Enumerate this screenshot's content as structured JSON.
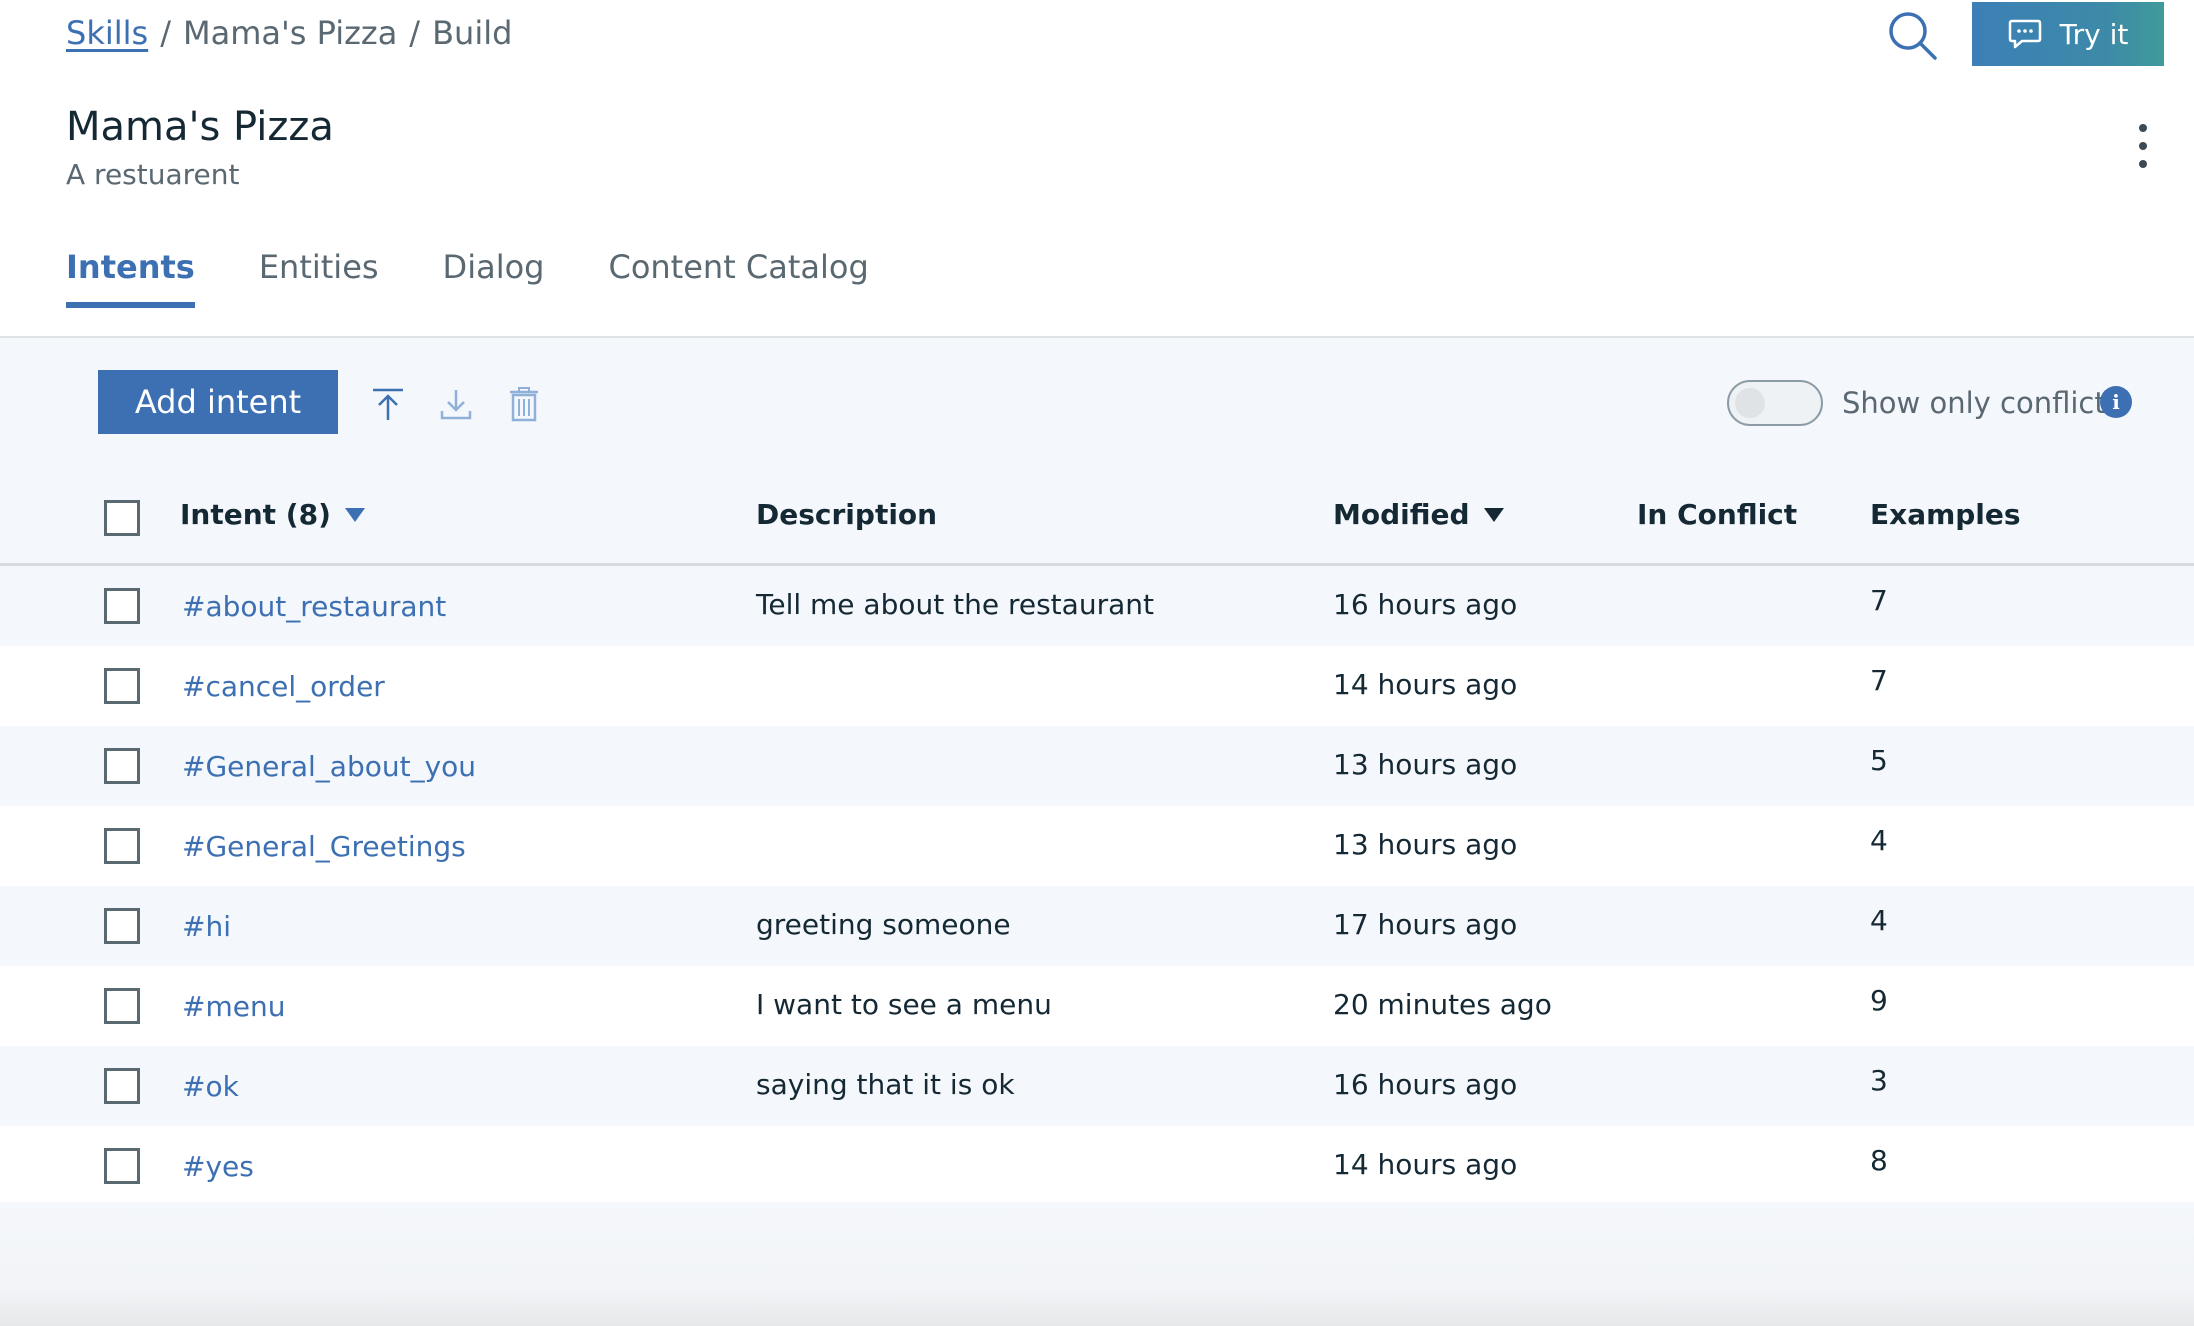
{
  "breadcrumb": {
    "root": "Skills",
    "middle": "Mama's Pizza",
    "current": "Build",
    "separator": "/"
  },
  "header": {
    "try_label": "Try it",
    "search_icon": "search-icon",
    "chat_icon": "chat-icon"
  },
  "skill": {
    "title": "Mama's Pizza",
    "subtitle": "A restuarent"
  },
  "tabs": [
    {
      "label": "Intents",
      "active": true
    },
    {
      "label": "Entities",
      "active": false
    },
    {
      "label": "Dialog",
      "active": false
    },
    {
      "label": "Content Catalog",
      "active": false
    }
  ],
  "toolbar": {
    "add_label": "Add intent",
    "upload_icon": "upload-icon",
    "download_icon": "download-icon",
    "delete_icon": "trash-icon",
    "conflicts_label": "Show only conflicts",
    "conflicts_on": false
  },
  "table": {
    "headers": {
      "intent": "Intent (8)",
      "description": "Description",
      "modified": "Modified",
      "conflict": "In Conflict",
      "examples": "Examples"
    },
    "rows": [
      {
        "intent": "#about_restaurant",
        "description": "Tell me about the restaurant",
        "modified": "16 hours ago",
        "examples": "7"
      },
      {
        "intent": "#cancel_order",
        "description": "",
        "modified": "14 hours ago",
        "examples": "7"
      },
      {
        "intent": "#General_about_you",
        "description": "",
        "modified": "13 hours ago",
        "examples": "5"
      },
      {
        "intent": "#General_Greetings",
        "description": "",
        "modified": "13 hours ago",
        "examples": "4"
      },
      {
        "intent": "#hi",
        "description": "greeting someone",
        "modified": "17 hours ago",
        "examples": "4"
      },
      {
        "intent": "#menu",
        "description": "I want to see a menu",
        "modified": "20 minutes ago",
        "examples": "9"
      },
      {
        "intent": "#ok",
        "description": "saying that it is ok",
        "modified": "16 hours ago",
        "examples": "3"
      },
      {
        "intent": "#yes",
        "description": "",
        "modified": "14 hours ago",
        "examples": "8"
      }
    ]
  },
  "colors": {
    "accent": "#3d70b2",
    "text": "#152935",
    "muted": "#5a6872",
    "band": "#f4f7fb"
  }
}
